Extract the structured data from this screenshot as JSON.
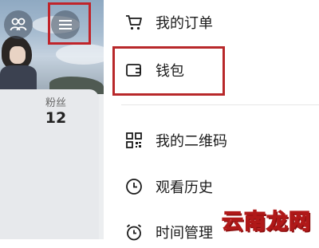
{
  "profile": {
    "fans_label": "粉丝",
    "fans_count": "12"
  },
  "header_icons": {
    "friends": "people-icon",
    "menu": "hamburger-menu-icon"
  },
  "menu": {
    "orders": {
      "label": "我的订单",
      "icon": "cart-icon"
    },
    "wallet": {
      "label": "钱包",
      "icon": "wallet-icon"
    },
    "qrcode": {
      "label": "我的二维码",
      "icon": "qrcode-icon"
    },
    "history": {
      "label": "观看历史",
      "icon": "clock-icon"
    },
    "time_management": {
      "label": "时间管理",
      "icon": "alarm-icon"
    }
  },
  "annotation": {
    "highlight_color": "#c0242a"
  },
  "watermark": {
    "text": "云南龙网"
  }
}
